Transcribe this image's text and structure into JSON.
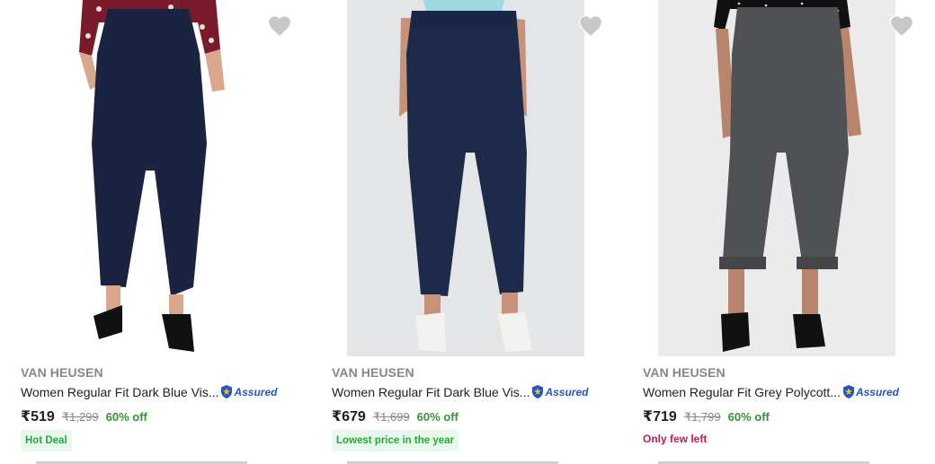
{
  "products": [
    {
      "brand": "VAN HEUSEN",
      "title": "Women Regular Fit Dark Blue Vis...",
      "assured": "Assured",
      "price": "₹519",
      "mrp": "₹1,299",
      "discount": "60% off",
      "badge": "Hot Deal",
      "stock_note": "",
      "image": "navy-skinny-pants-photo",
      "pant_color": "#1a2340"
    },
    {
      "brand": "VAN HEUSEN",
      "title": "Women Regular Fit Dark Blue Vis...",
      "assured": "Assured",
      "price": "₹679",
      "mrp": "₹1,699",
      "discount": "60% off",
      "badge": "Lowest price in the year",
      "stock_note": "",
      "image": "navy-relaxed-pants-photo",
      "pant_color": "#1d2a4a"
    },
    {
      "brand": "VAN HEUSEN",
      "title": "Women Regular Fit Grey Polycott...",
      "assured": "Assured",
      "price": "₹719",
      "mrp": "₹1,799",
      "discount": "60% off",
      "badge": "",
      "stock_note": "Only few left",
      "image": "grey-cropped-pants-photo",
      "pant_color": "#505155"
    }
  ],
  "colors": {
    "brand_text": "#878787",
    "discount": "#388e3c",
    "assured": "#2455c4",
    "stock_warning": "#c2185b",
    "heart": "#c8c8c8"
  }
}
